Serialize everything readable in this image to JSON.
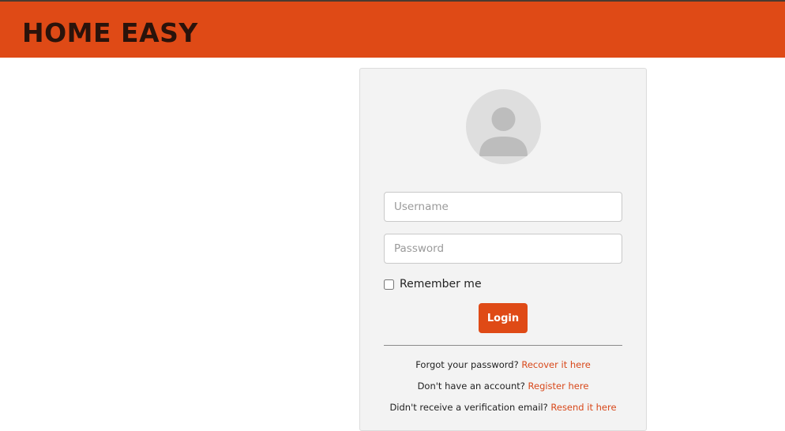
{
  "header": {
    "brand": "HOME EASY"
  },
  "login_card": {
    "username_placeholder": "Username",
    "password_placeholder": "Password",
    "remember_label": "Remember me",
    "login_label": "Login",
    "avatar_icon": "user-avatar-icon",
    "links": [
      {
        "text": "Forgot your password?",
        "link": "Recover it here"
      },
      {
        "text": "Don't have an account?",
        "link": "Register here"
      },
      {
        "text": "Didn't receive a verification email?",
        "link": "Resend it here"
      }
    ]
  },
  "colors": {
    "brand": "#df4a16",
    "brand_text": "#2a130b",
    "card_bg": "#f3f3f3",
    "link": "#d8481a"
  }
}
